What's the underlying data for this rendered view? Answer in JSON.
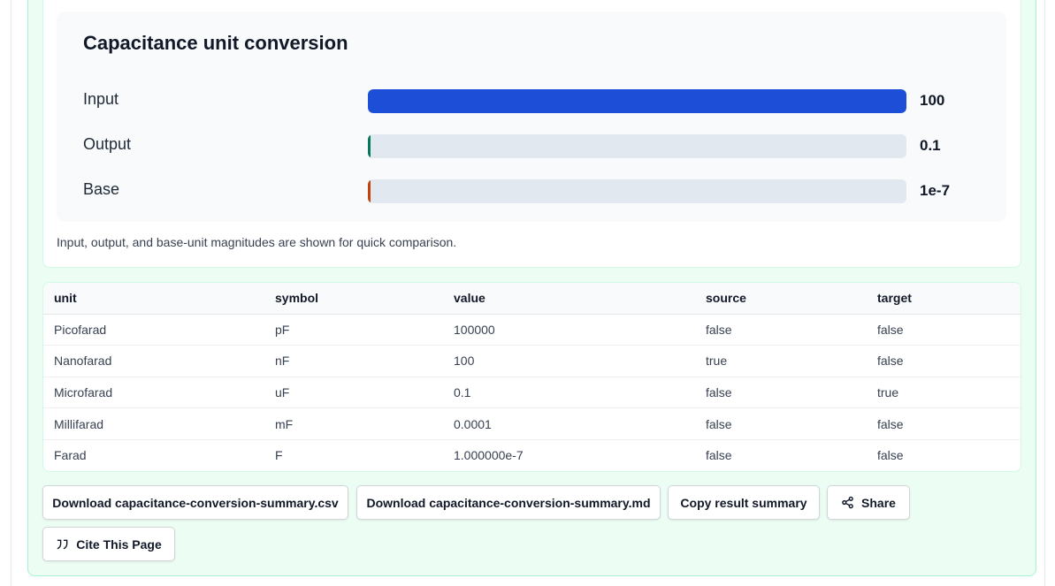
{
  "chart": {
    "title": "Capacitance unit conversion",
    "note": "Input, output, and base-unit magnitudes are shown for quick comparison.",
    "bars": [
      {
        "label": "Input",
        "value_text": "100",
        "fill_fraction": 1.0,
        "color": "#1d4ed8"
      },
      {
        "label": "Output",
        "value_text": "0.1",
        "fill_fraction": 0.001,
        "color": "#047857"
      },
      {
        "label": "Base",
        "value_text": "1e-7",
        "fill_fraction": 1e-09,
        "color": "#c2410c"
      }
    ]
  },
  "table": {
    "headers": [
      "unit",
      "symbol",
      "value",
      "source",
      "target"
    ],
    "rows": [
      [
        "Picofarad",
        "pF",
        "100000",
        "false",
        "false"
      ],
      [
        "Nanofarad",
        "nF",
        "100",
        "true",
        "false"
      ],
      [
        "Microfarad",
        "uF",
        "0.1",
        "false",
        "true"
      ],
      [
        "Millifarad",
        "mF",
        "0.0001",
        "false",
        "false"
      ],
      [
        "Farad",
        "F",
        "1.000000e-7",
        "false",
        "false"
      ]
    ]
  },
  "actions": {
    "download_csv": "Download capacitance-conversion-summary.csv",
    "download_md": "Download capacitance-conversion-summary.md",
    "copy_summary": "Copy result summary",
    "share": "Share",
    "cite": "Cite This Page"
  },
  "icons": {
    "share": "share-icon",
    "cite": "quote-icon"
  }
}
